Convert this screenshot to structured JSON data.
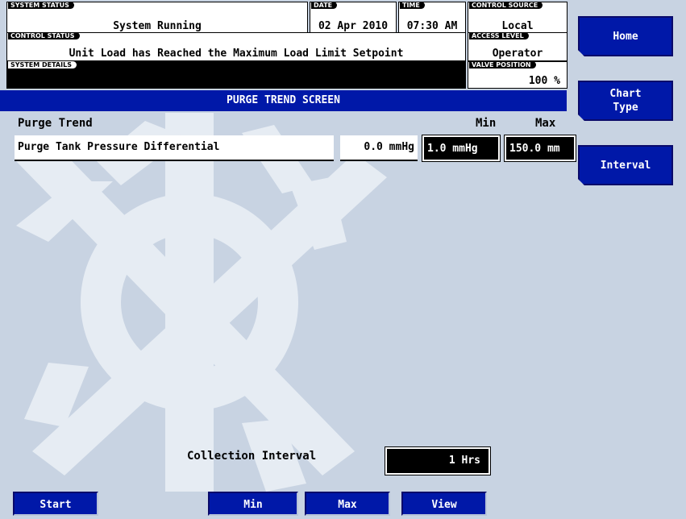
{
  "status": {
    "system_status": {
      "label": "SYSTEM STATUS",
      "value": "System Running"
    },
    "date": {
      "label": "DATE",
      "value": "02 Apr 2010"
    },
    "time": {
      "label": "TIME",
      "value": "07:30 AM"
    },
    "control_source": {
      "label": "CONTROL SOURCE",
      "value": "Local"
    },
    "control_status": {
      "label": "CONTROL STATUS",
      "value": "Unit Load has Reached the Maximum Load Limit Setpoint"
    },
    "access_level": {
      "label": "ACCESS LEVEL",
      "value": "Operator"
    },
    "system_details": {
      "label": "SYSTEM DETAILS",
      "value": ""
    },
    "valve_position": {
      "label": "VALVE POSITION",
      "value": "100 %"
    }
  },
  "screen": {
    "title": "PURGE TREND SCREEN"
  },
  "side_buttons": {
    "home": "Home",
    "chart_type_line1": "Chart",
    "chart_type_line2": "Type",
    "interval": "Interval"
  },
  "trend": {
    "header_label": "Purge Trend",
    "min_header": "Min",
    "max_header": "Max",
    "point_name": "Purge Tank Pressure Differential",
    "current_value": "0.0 mmHg",
    "min_value": "1.0 mmHg",
    "max_value": "150.0 mm"
  },
  "collection": {
    "label": "Collection Interval",
    "value": "1 Hrs"
  },
  "bottom_buttons": {
    "start": "Start",
    "min": "Min",
    "max": "Max",
    "view": "View"
  },
  "colors": {
    "background": "#c8d3e2",
    "button_blue": "#0018a8",
    "watermark": "#e6ecf3"
  }
}
